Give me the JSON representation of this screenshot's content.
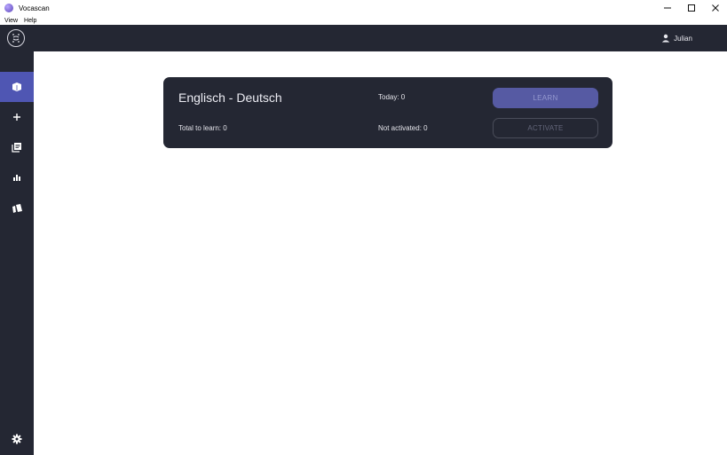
{
  "window": {
    "title": "Vocascan",
    "minimize_icon": "minimize-icon",
    "maximize_icon": "maximize-icon",
    "close_icon": "close-icon"
  },
  "menu": {
    "items": [
      "View",
      "Help"
    ]
  },
  "header": {
    "user_name": "Julian",
    "logo_icon": "vocascan-logo-icon",
    "user_icon": "user-icon"
  },
  "sidebar": {
    "items": [
      {
        "name": "dashboard",
        "icon": "book-icon",
        "active": true
      },
      {
        "name": "add",
        "icon": "plus-icon",
        "active": false
      },
      {
        "name": "library",
        "icon": "collection-icon",
        "active": false
      },
      {
        "name": "statistics",
        "icon": "bar-chart-icon",
        "active": false
      },
      {
        "name": "cards",
        "icon": "cards-icon",
        "active": false
      }
    ],
    "settings_icon": "gear-icon"
  },
  "card": {
    "title": "Englisch - Deutsch",
    "today": "Today: 0",
    "total_to_learn": "Total to learn: 0",
    "not_activated": "Not activated: 0",
    "learn_label": "LEARN",
    "activate_label": "ACTIVATE"
  },
  "colors": {
    "dark": "#242733",
    "accent": "#4f56b3"
  }
}
